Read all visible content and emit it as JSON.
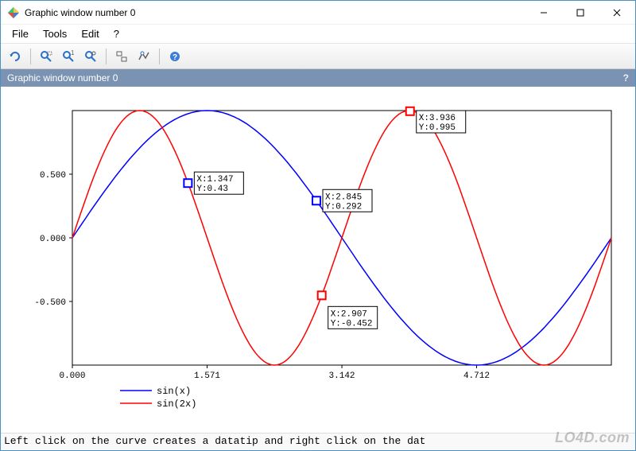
{
  "window": {
    "title": "Graphic window number 0"
  },
  "menus": {
    "file": "File",
    "tools": "Tools",
    "edit": "Edit",
    "help": "?"
  },
  "toolbar_icons": {
    "rotate": "rotate-icon",
    "zoom_area": "zoom-area-icon",
    "zoom_in": "zoom-in-icon",
    "zoom_out": "zoom-out-icon",
    "toggle_datatip": "datatip-toggle-icon",
    "datatip_mode": "datatip-mode-icon",
    "help": "help-icon"
  },
  "banner": {
    "title": "Graphic window number 0",
    "help": "?"
  },
  "chart_data": {
    "type": "line",
    "xlabel": "",
    "ylabel": "",
    "xlim": [
      0,
      6.283
    ],
    "ylim": [
      -1,
      1
    ],
    "xticks": [
      "0.000",
      "1.571",
      "3.142",
      "4.712"
    ],
    "yticks": [
      "-0.500",
      "0.000",
      "0.500"
    ],
    "series": [
      {
        "name": "sin(x)",
        "color": "#0000ff",
        "function": "sin",
        "freq": 1
      },
      {
        "name": "sin(2x)",
        "color": "#ff0000",
        "function": "sin",
        "freq": 2
      }
    ],
    "legend_position": "bottom",
    "datatips": [
      {
        "series": 0,
        "x": 1.347,
        "y": 0.43,
        "label_x": "X:1.347",
        "label_y": "Y:0.43",
        "label_side": "right"
      },
      {
        "series": 0,
        "x": 2.845,
        "y": 0.292,
        "label_x": "X:2.845",
        "label_y": "Y:0.292",
        "label_side": "right"
      },
      {
        "series": 1,
        "x": 2.907,
        "y": -0.452,
        "label_x": "X:2.907",
        "label_y": "Y:-0.452",
        "label_side": "right-below"
      },
      {
        "series": 1,
        "x": 3.936,
        "y": 0.995,
        "label_x": "X:3.936",
        "label_y": "Y:0.995",
        "label_side": "right"
      }
    ]
  },
  "status": {
    "text": "Left click on the curve creates a datatip and right click on the dat"
  },
  "watermark": "LO4D.com"
}
